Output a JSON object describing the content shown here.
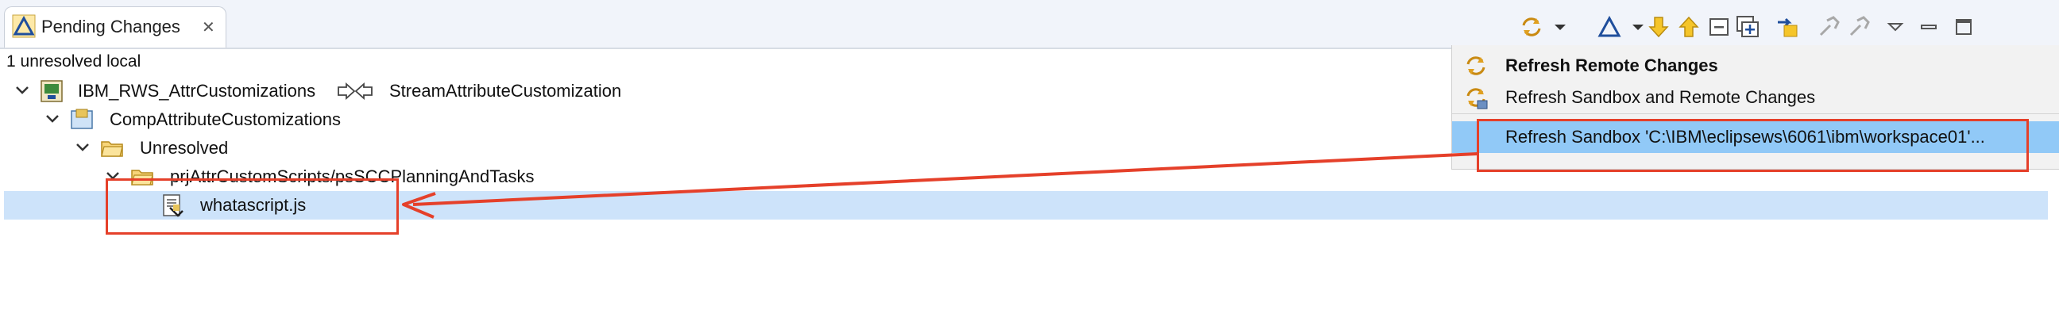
{
  "tab": {
    "title": "Pending Changes",
    "close": "✕"
  },
  "status": "1 unresolved local",
  "tree": [
    {
      "label": "IBM_RWS_AttrCustomizations",
      "flow_icon": "flow-arrows-icon",
      "target": "StreamAttributeCustomization"
    },
    {
      "label": "CompAttributeCustomizations"
    },
    {
      "label": "Unresolved"
    },
    {
      "label": "prjAttrCustomScripts/psSCCPlanningAndTasks"
    },
    {
      "label": "whatascript.js"
    }
  ],
  "menu": [
    {
      "label": "Refresh Remote Changes",
      "icon": "refresh-remote-icon"
    },
    {
      "label": "Refresh Sandbox and Remote Changes",
      "icon": "refresh-sandbox-remote-icon"
    },
    {
      "label": "Refresh Sandbox 'C:\\IBM\\eclipsews\\6061\\ibm\\workspace01'..."
    }
  ],
  "toolbar_icons": [
    "refresh-icon",
    "dropdown-arrow-icon",
    "delta-icon",
    "dropdown-arrow-icon",
    "down-arrow-icon",
    "up-arrow-icon",
    "collapse-all-icon",
    "expand-all-icon",
    "accept-icon",
    "tool-icon",
    "tool-icon",
    "view-menu-icon",
    "minimize-icon",
    "maximize-icon"
  ],
  "colors": {
    "selection": "#cde3fa",
    "menu_highlight": "#91c9f7",
    "annotation": "#e5402a"
  }
}
